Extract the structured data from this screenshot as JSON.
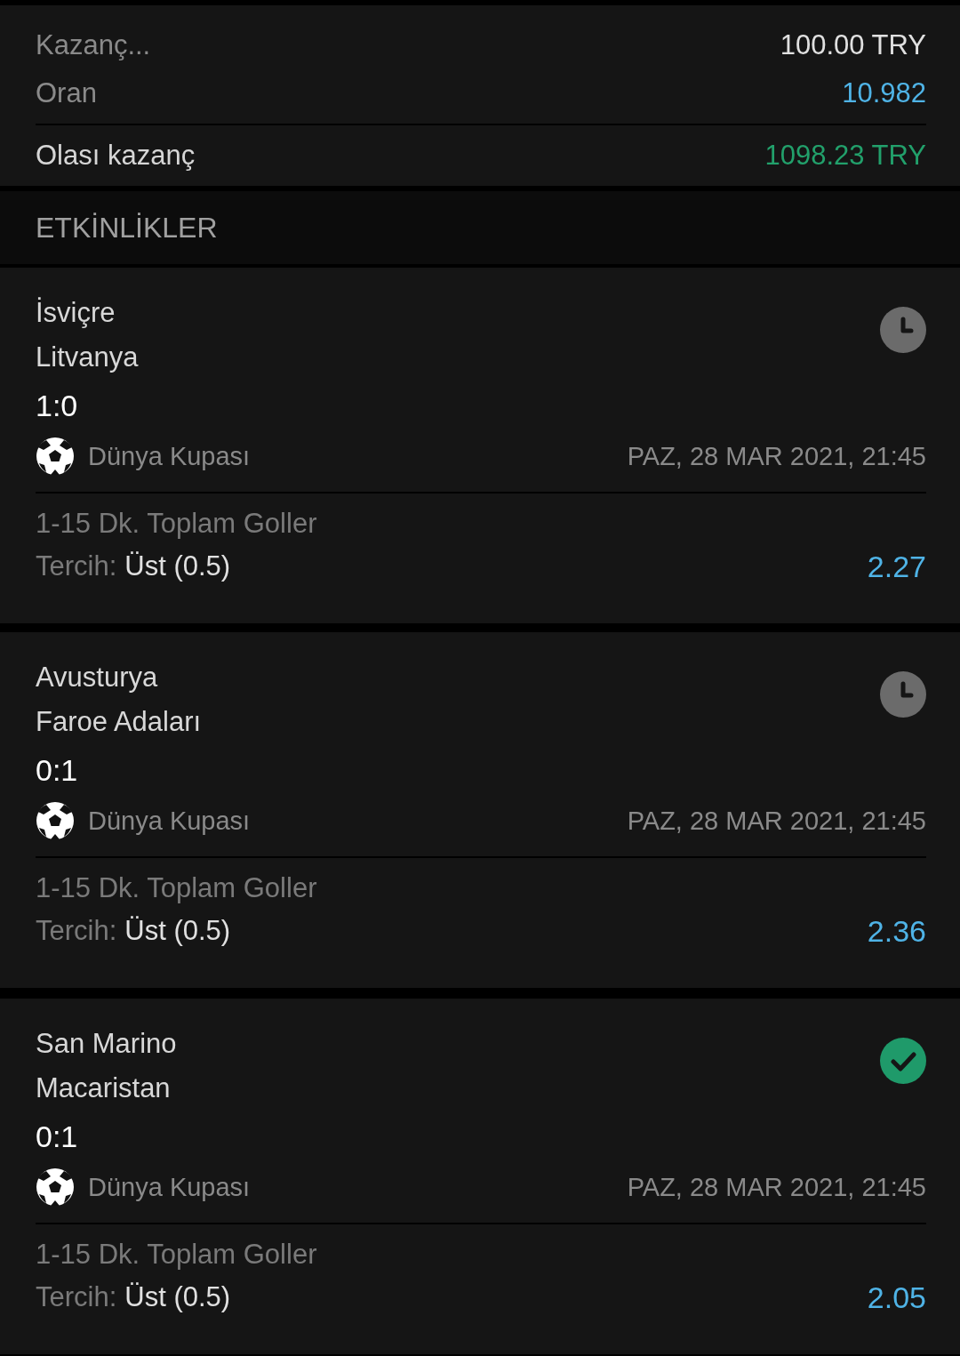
{
  "summary": {
    "rows": [
      {
        "label": "Kazanç...",
        "value": "100.00 TRY",
        "kind": "stake"
      },
      {
        "label": "Oran",
        "value": "10.982",
        "kind": "odds"
      },
      {
        "label": "Olası kazanç",
        "value": "1098.23 TRY",
        "kind": "payout"
      }
    ]
  },
  "events_header": "ETKİNLİKLER",
  "events": [
    {
      "home": "İsviçre",
      "away": "Litvanya",
      "score": "1:0",
      "kind": "pending",
      "league": "Dünya Kupası",
      "date": "PAZ, 28 MAR 2021, 21:45",
      "market": "1-15 Dk. Toplam Goller",
      "pick_label": "Tercih:",
      "pick": "Üst (0.5)",
      "odds": "2.27"
    },
    {
      "home": "Avusturya",
      "away": "Faroe Adaları",
      "score": "0:1",
      "kind": "pending",
      "league": "Dünya Kupası",
      "date": "PAZ, 28 MAR 2021, 21:45",
      "market": "1-15 Dk. Toplam Goller",
      "pick_label": "Tercih:",
      "pick": "Üst (0.5)",
      "odds": "2.36"
    },
    {
      "home": "San Marino",
      "away": "Macaristan",
      "score": "0:1",
      "kind": "won",
      "league": "Dünya Kupası",
      "date": "PAZ, 28 MAR 2021, 21:45",
      "market": "1-15 Dk. Toplam Goller",
      "pick_label": "Tercih:",
      "pick": "Üst (0.5)",
      "odds": "2.05"
    }
  ]
}
